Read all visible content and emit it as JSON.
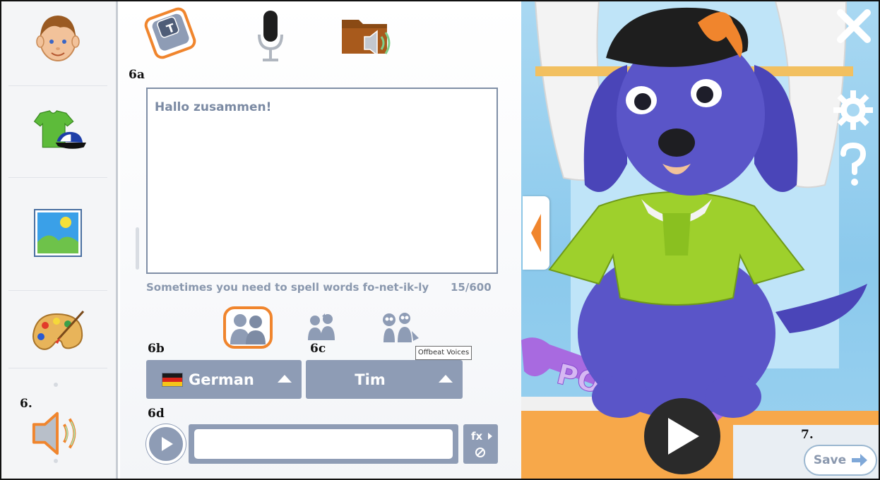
{
  "annotations": {
    "a6a": "6a",
    "a6b": "6b",
    "a6c": "6c",
    "a6d": "6d",
    "a6": "6.",
    "a7": "7."
  },
  "sidebar": {
    "items": [
      {
        "icon": "boy-face-icon"
      },
      {
        "icon": "tshirt-cap-icon"
      },
      {
        "icon": "picture-icon"
      },
      {
        "icon": "paint-palette-icon"
      },
      {
        "icon": "speaker-icon"
      }
    ]
  },
  "modes": [
    {
      "icon": "keyboard-t-icon",
      "active": true
    },
    {
      "icon": "microphone-icon"
    },
    {
      "icon": "audio-folder-icon"
    }
  ],
  "textbox": {
    "value": "Hallo zusammen!"
  },
  "hint": "Sometimes you need to spell words fo-net-ik-ly",
  "counter": "15/600",
  "voice_tabs": [
    {
      "icon": "adult-voices-icon",
      "active": true
    },
    {
      "icon": "kid-voices-icon"
    },
    {
      "icon": "offbeat-voices-icon"
    }
  ],
  "tooltip": "Offbeat Voices",
  "language_select": {
    "value": "German"
  },
  "voice_select": {
    "value": "Tim"
  },
  "fx_button": {
    "label": "fx"
  },
  "scene": {
    "bone_text": "POPPY"
  },
  "save_button": {
    "label": "Save"
  },
  "colors": {
    "accent": "#f0852d",
    "control": "#8e9cb5",
    "text_muted": "#8a98ae",
    "dog": "#5a55c8",
    "shirt": "#9ed02c"
  }
}
